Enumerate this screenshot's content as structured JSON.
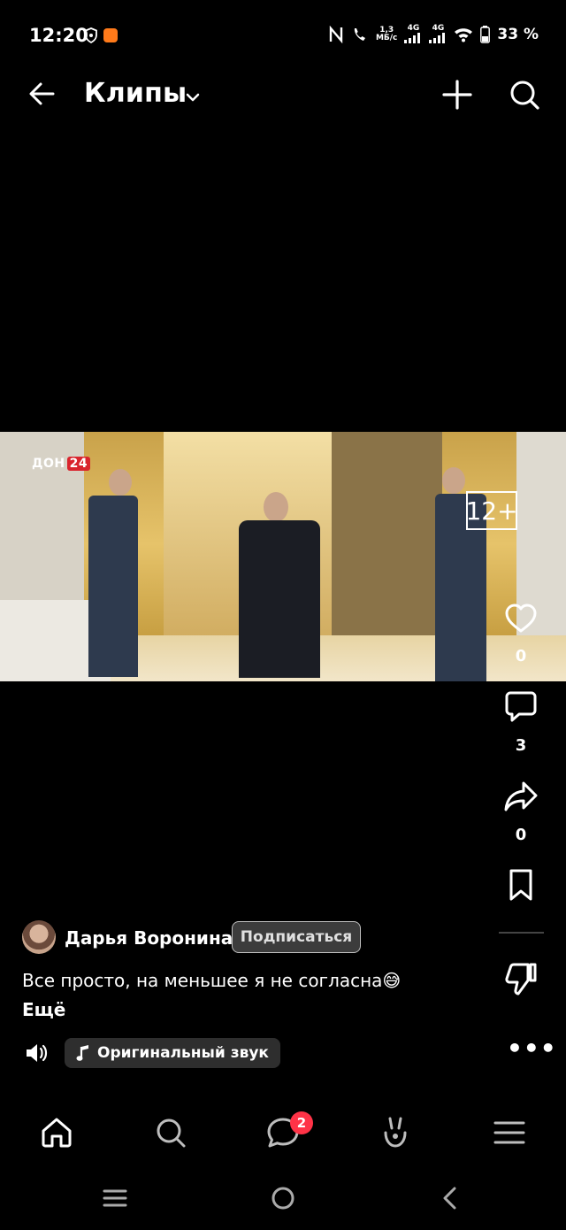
{
  "status_bar": {
    "time": "12:20",
    "speed_value": "1,3",
    "speed_unit": "МБ/с",
    "net1": "4G",
    "net2": "4G",
    "battery": "33 %"
  },
  "header": {
    "title": "Клипы"
  },
  "video": {
    "watermark_text": "ДОН",
    "watermark_badge": "24",
    "age_rating": "12+"
  },
  "actions": {
    "likes": "0",
    "comments": "3",
    "shares": "0"
  },
  "post": {
    "author_name": "Дарья Воронина",
    "subscribe_label": "Подписаться",
    "caption": "Все просто, на меньшее я не согласна😅",
    "more_label": "Ещё",
    "audio_label": "Оригинальный звук"
  },
  "nav": {
    "messages_badge": "2"
  },
  "colors": {
    "background": "#000000",
    "badge": "#ff3347",
    "chip": "#2e2e2e"
  }
}
